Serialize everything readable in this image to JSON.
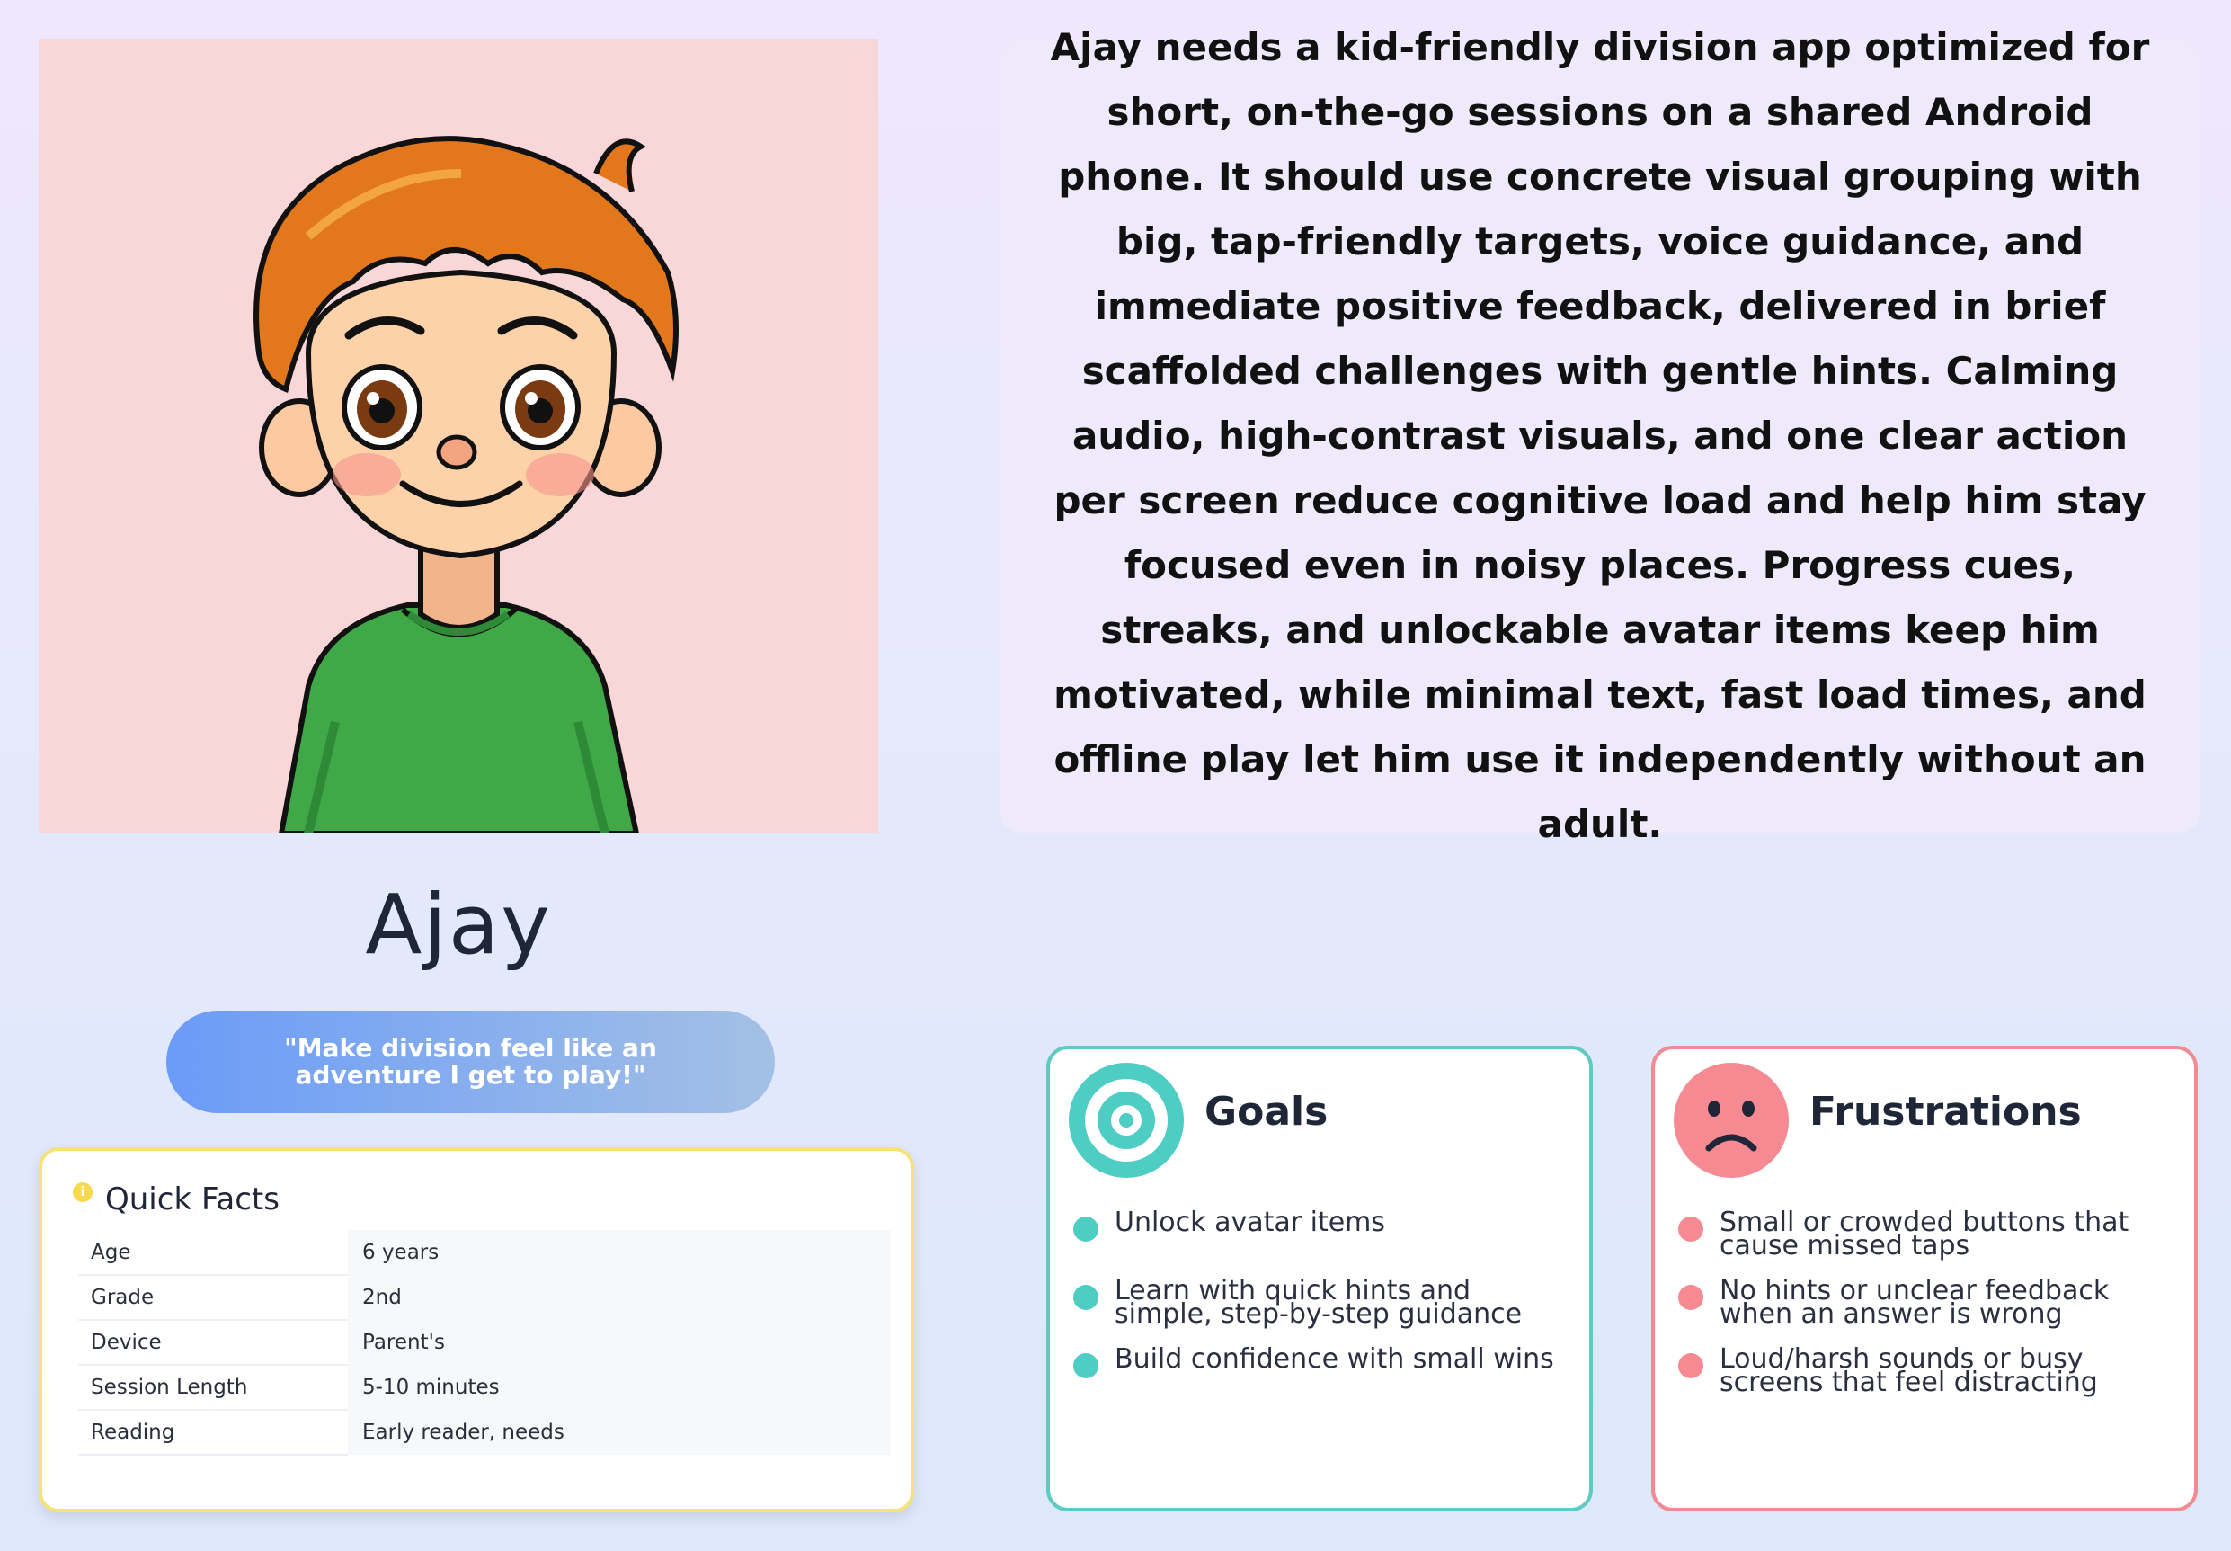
{
  "persona": {
    "name": "Ajay",
    "quote": "\"Make division feel like an adventure I get to play!\"",
    "summary": "Ajay needs a kid-friendly division app optimized for short, on-the-go sessions on a shared Android phone. It should use concrete visual grouping with big, tap-friendly targets, voice guidance, and immediate positive feedback, delivered in brief scaffolded challenges with gentle hints. Calming audio, high-contrast visuals, and one clear action per screen reduce cognitive load and help him stay focused even in noisy places. Progress cues, streaks, and unlockable avatar items keep him motivated, while minimal text, fast load times, and offline play let him use it independently without an adult."
  },
  "quick_facts": {
    "title": "Quick Facts",
    "icon": "info-icon",
    "rows": [
      {
        "label": "Age",
        "value": "6 years"
      },
      {
        "label": "Grade",
        "value": "2nd"
      },
      {
        "label": "Device",
        "value": "Parent's"
      },
      {
        "label": "Session Length",
        "value": "5-10 minutes"
      },
      {
        "label": "Reading",
        "value": "Early reader, needs"
      }
    ]
  },
  "goals": {
    "title": "Goals",
    "icon": "target-icon",
    "items": [
      "Unlock avatar items",
      "Learn with quick hints and simple, step-by-step guidance",
      "Build confidence with small wins"
    ]
  },
  "frustrations": {
    "title": "Frustrations",
    "icon": "sad-face-icon",
    "items": [
      "Small or crowded buttons that cause missed taps",
      "No hints or unclear feedback when an answer is wrong",
      "Loud/harsh sounds or busy screens that feel distracting"
    ]
  },
  "colors": {
    "goals_accent": "#4ecdc4",
    "frustrations_accent": "#f58a93",
    "facts_border": "#f7e27a",
    "quote_gradient_start": "#6a9bf7",
    "quote_gradient_end": "#a3c0e5"
  }
}
